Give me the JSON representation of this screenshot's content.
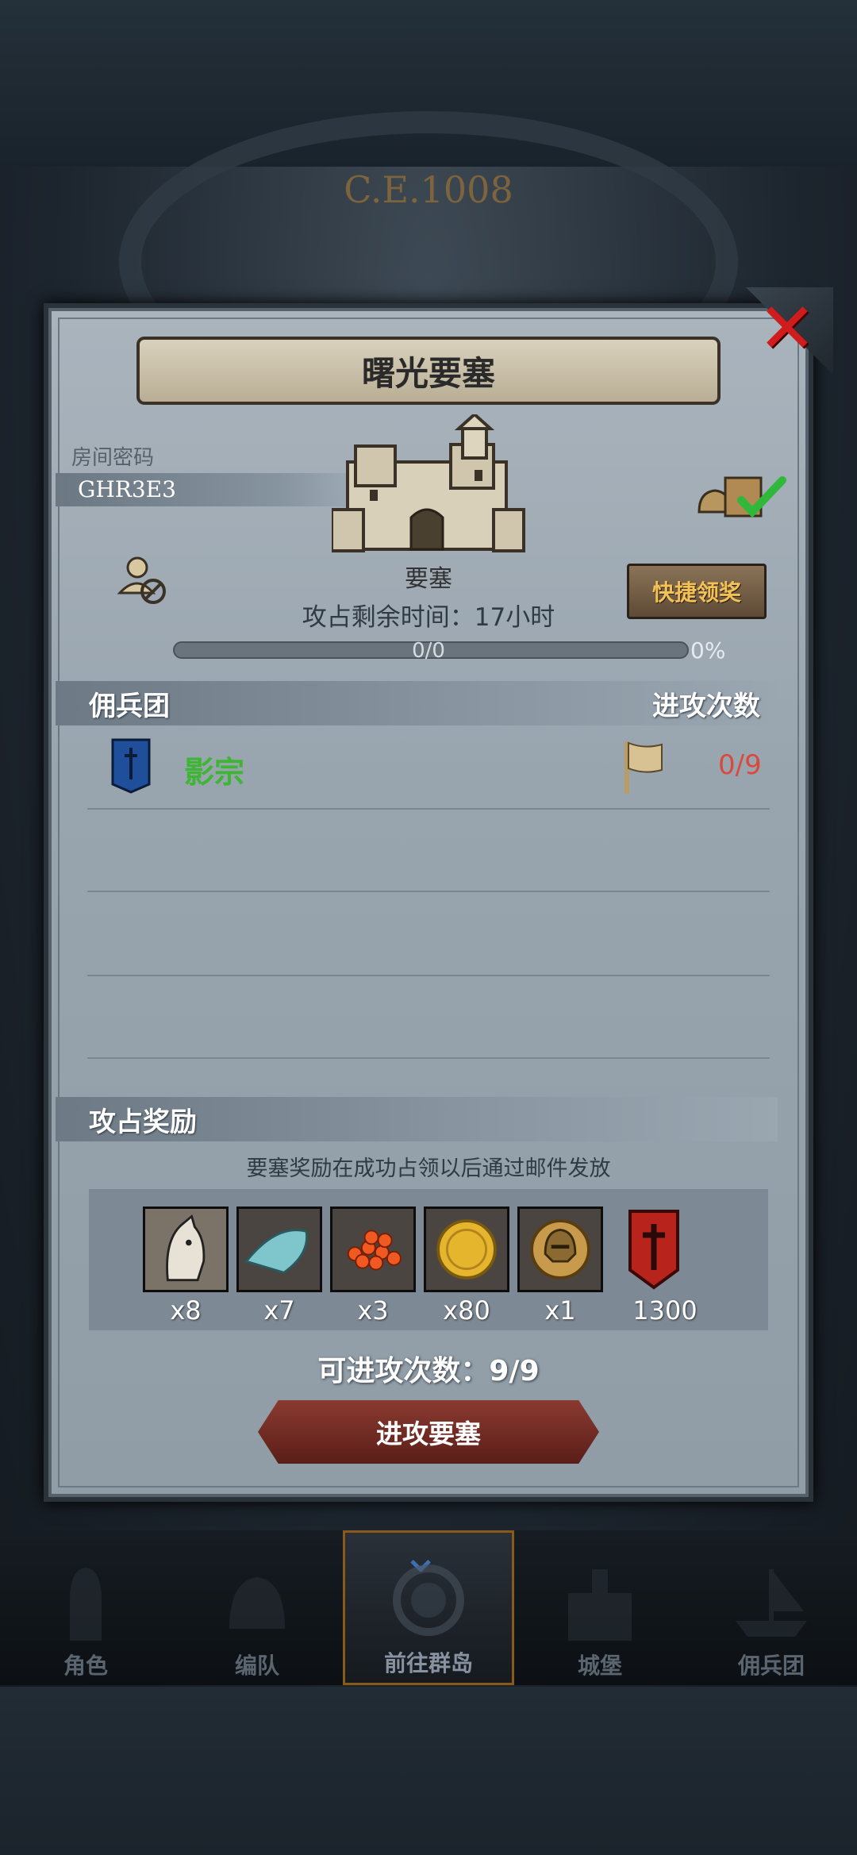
{
  "header": {
    "era": "C.E.1008"
  },
  "dialog": {
    "title": "曙光要塞",
    "room_label": "房间密码",
    "room_code": "GHR3E3",
    "building_label": "要塞",
    "timer_text": "攻占剩余时间：17小时",
    "quick_claim_label": "快捷领奖",
    "progress": {
      "text": "0/0",
      "percent_text": "0%",
      "fraction": 0
    },
    "close_icon": "close-icon"
  },
  "mercenary_section": {
    "title": "佣兵团",
    "right_label": "进攻次数",
    "rows": [
      {
        "name": "影宗",
        "count": "0/9",
        "banner_color": "#1f4f9a"
      }
    ]
  },
  "reward_section": {
    "title": "攻占奖励",
    "note": "要塞奖励在成功占领以后通过邮件发放",
    "items": [
      {
        "icon": "horse-icon",
        "qty": "x8"
      },
      {
        "icon": "cloth-icon",
        "qty": "x7"
      },
      {
        "icon": "roe-icon",
        "qty": "x3"
      },
      {
        "icon": "gold-coin-icon",
        "qty": "x80"
      },
      {
        "icon": "helmet-coin-icon",
        "qty": "x1"
      },
      {
        "icon": "guild-banner-icon",
        "qty": "1300"
      }
    ]
  },
  "attempts_text": "可进攻次数：9/9",
  "attack_button": "进攻要塞",
  "nav": [
    {
      "label": "角色",
      "icon": "knight-icon",
      "active": false
    },
    {
      "label": "编队",
      "icon": "helmet-icon",
      "active": false
    },
    {
      "label": "前往群岛",
      "icon": "compass-icon",
      "active": true
    },
    {
      "label": "城堡",
      "icon": "castle-icon",
      "active": false
    },
    {
      "label": "佣兵团",
      "icon": "ship-icon",
      "active": false
    }
  ],
  "colors": {
    "accent_gold": "#f3c257",
    "guild_green": "#3fb534",
    "count_red": "#d94a3c"
  }
}
